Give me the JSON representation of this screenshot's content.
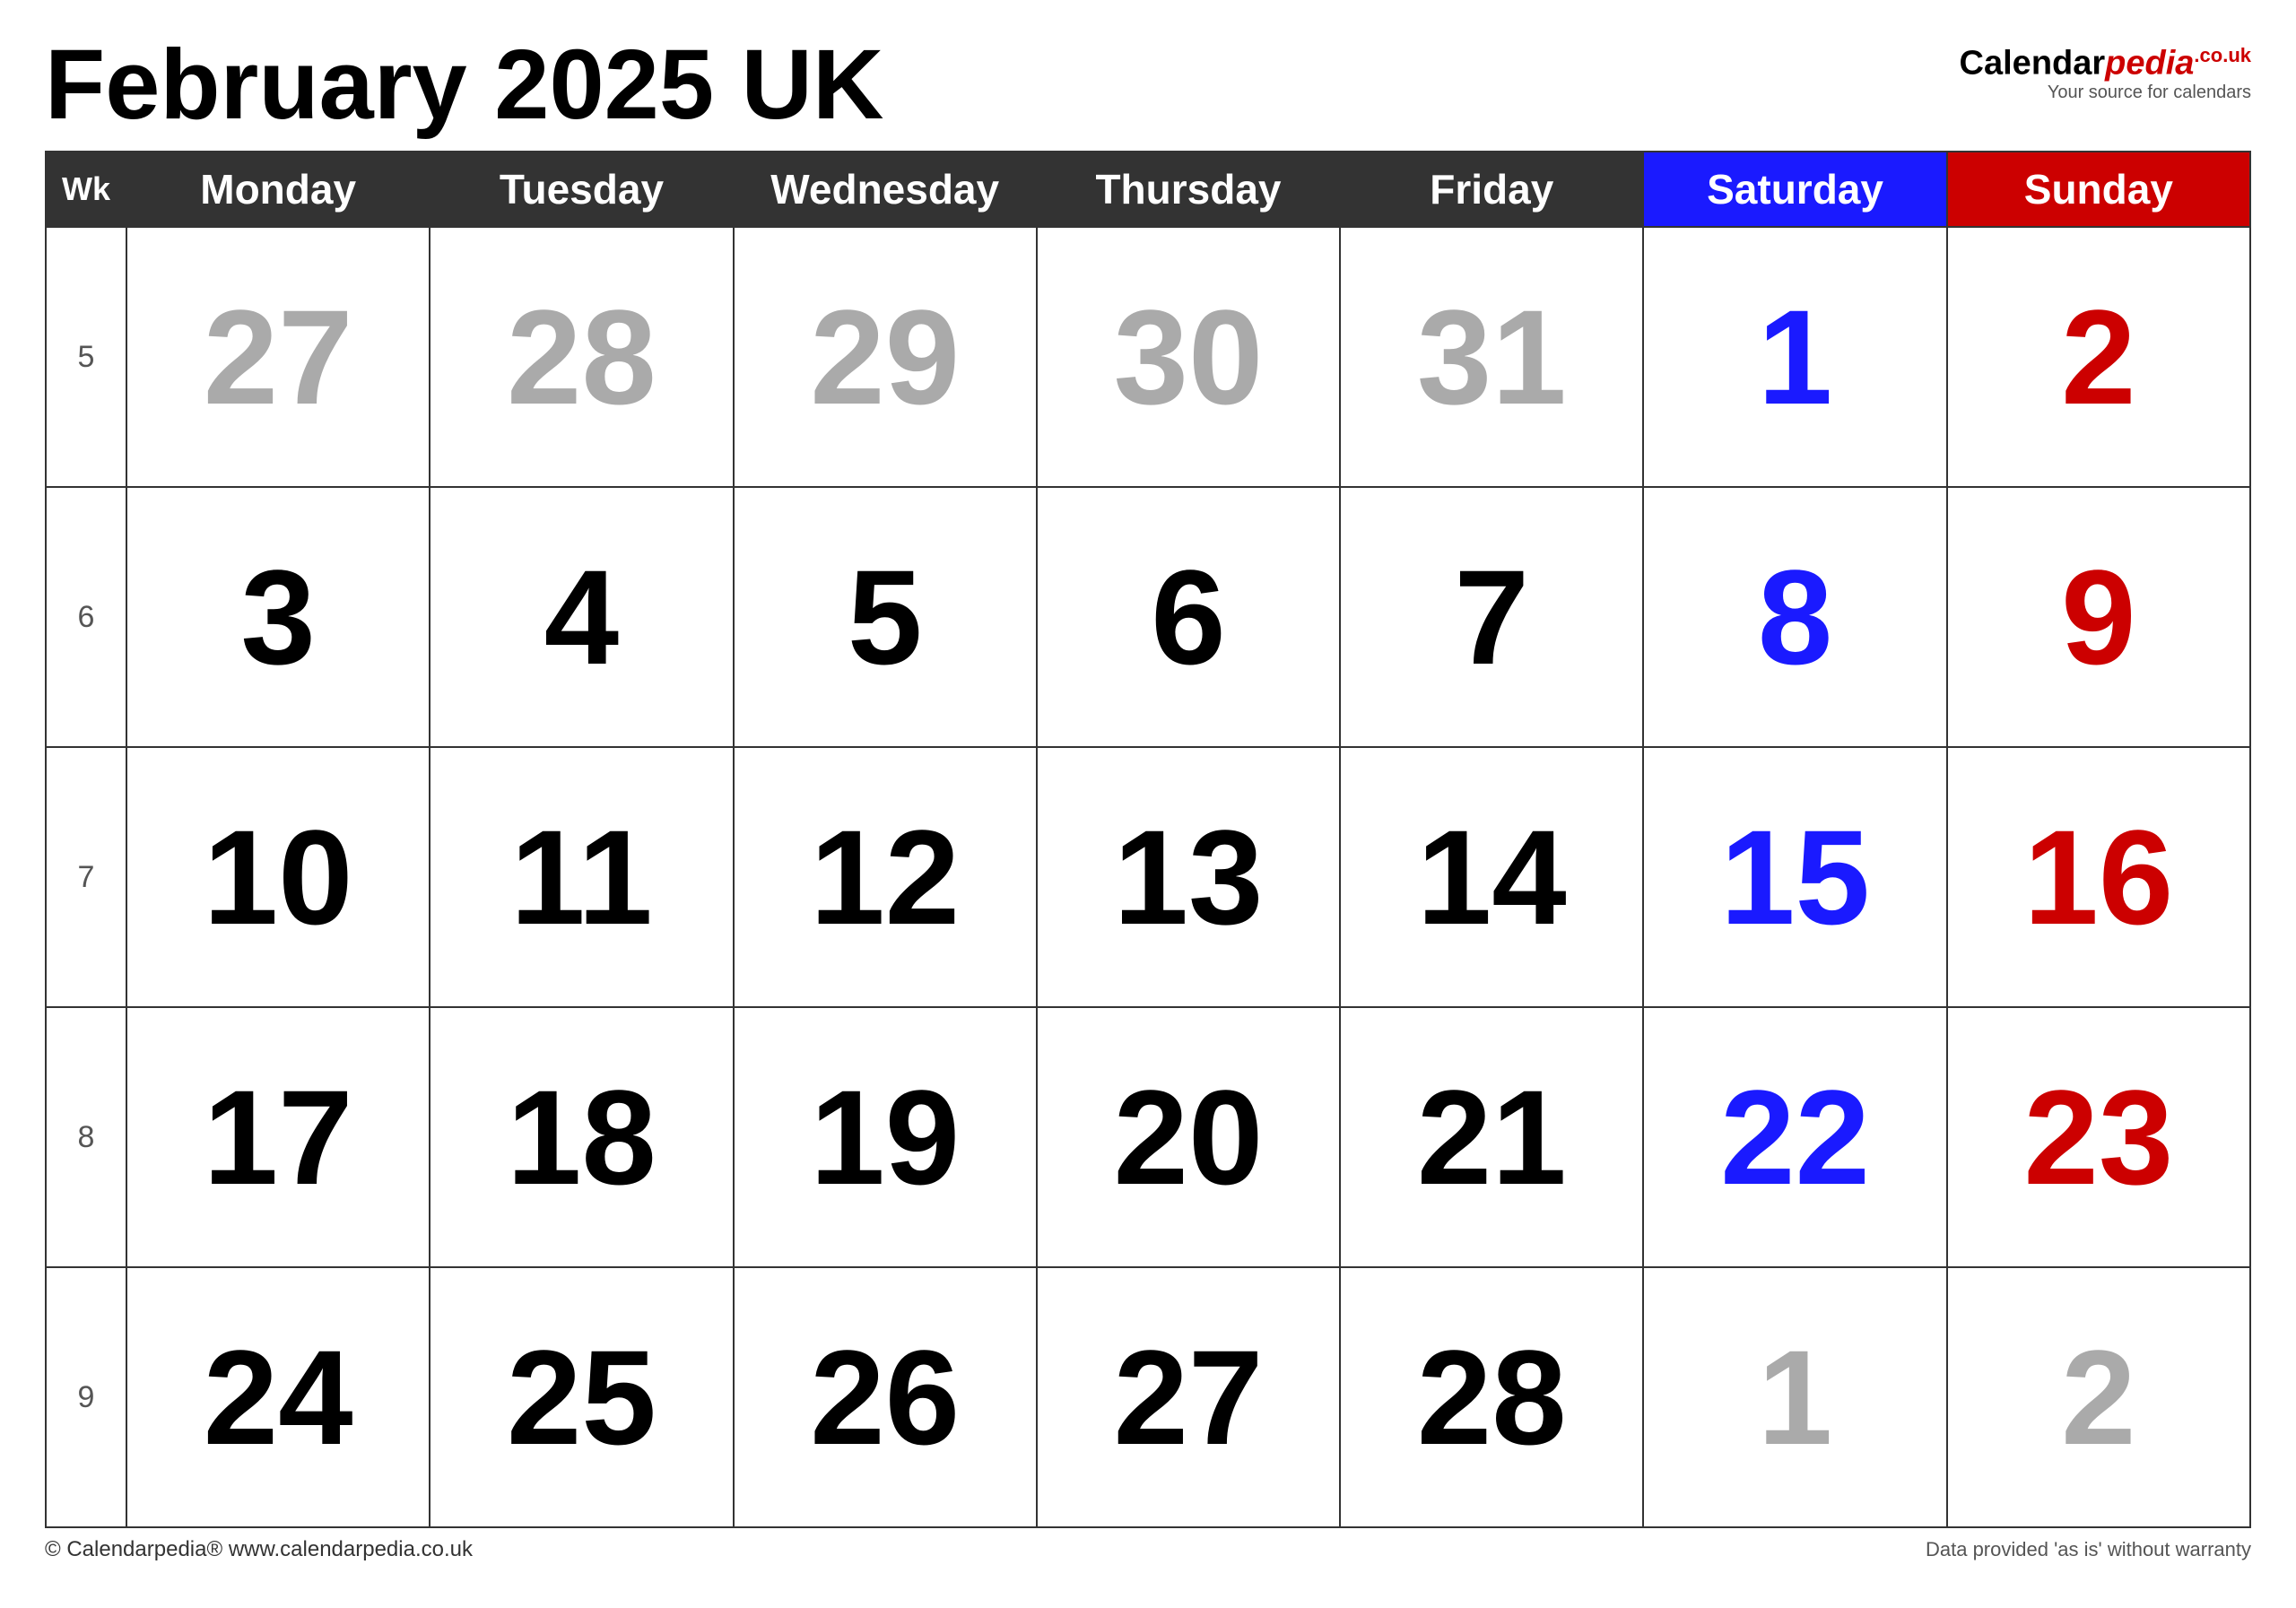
{
  "title": "February 2025 UK",
  "logo": {
    "brand": "Calendar",
    "brand_italic": "pedia",
    "couk": ".co.uk",
    "subtitle": "Your source for calendars"
  },
  "headers": {
    "wk": "Wk",
    "mon": "Monday",
    "tue": "Tuesday",
    "wed": "Wednesday",
    "thu": "Thursday",
    "fri": "Friday",
    "sat": "Saturday",
    "sun": "Sunday"
  },
  "weeks": [
    {
      "wk": "5",
      "days": [
        {
          "num": "27",
          "style": "gray"
        },
        {
          "num": "28",
          "style": "gray"
        },
        {
          "num": "29",
          "style": "gray"
        },
        {
          "num": "30",
          "style": "gray"
        },
        {
          "num": "31",
          "style": "gray"
        },
        {
          "num": "1",
          "style": "blue"
        },
        {
          "num": "2",
          "style": "red"
        }
      ]
    },
    {
      "wk": "6",
      "days": [
        {
          "num": "3",
          "style": "black"
        },
        {
          "num": "4",
          "style": "black"
        },
        {
          "num": "5",
          "style": "black"
        },
        {
          "num": "6",
          "style": "black"
        },
        {
          "num": "7",
          "style": "black"
        },
        {
          "num": "8",
          "style": "blue"
        },
        {
          "num": "9",
          "style": "red"
        }
      ]
    },
    {
      "wk": "7",
      "days": [
        {
          "num": "10",
          "style": "black"
        },
        {
          "num": "11",
          "style": "black"
        },
        {
          "num": "12",
          "style": "black"
        },
        {
          "num": "13",
          "style": "black"
        },
        {
          "num": "14",
          "style": "black"
        },
        {
          "num": "15",
          "style": "blue"
        },
        {
          "num": "16",
          "style": "red"
        }
      ]
    },
    {
      "wk": "8",
      "days": [
        {
          "num": "17",
          "style": "black"
        },
        {
          "num": "18",
          "style": "black"
        },
        {
          "num": "19",
          "style": "black"
        },
        {
          "num": "20",
          "style": "black"
        },
        {
          "num": "21",
          "style": "black"
        },
        {
          "num": "22",
          "style": "blue"
        },
        {
          "num": "23",
          "style": "red"
        }
      ]
    },
    {
      "wk": "9",
      "days": [
        {
          "num": "24",
          "style": "black"
        },
        {
          "num": "25",
          "style": "black"
        },
        {
          "num": "26",
          "style": "black"
        },
        {
          "num": "27",
          "style": "black"
        },
        {
          "num": "28",
          "style": "black"
        },
        {
          "num": "1",
          "style": "gray"
        },
        {
          "num": "2",
          "style": "gray"
        }
      ]
    }
  ],
  "footer": {
    "left": "© Calendarpedia®  www.calendarpedia.co.uk",
    "right": "Data provided 'as is' without warranty"
  }
}
